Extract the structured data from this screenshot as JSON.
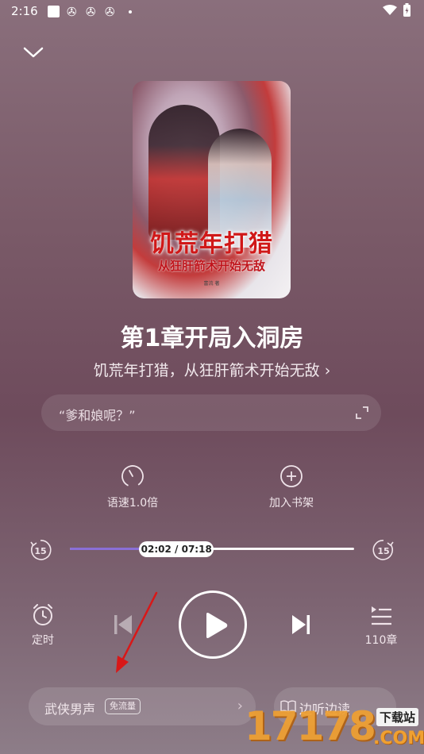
{
  "status_bar": {
    "time": "2:16"
  },
  "book": {
    "cover_title": "饥荒年打猎",
    "cover_subtitle": "从狂肝箭术开始无敌",
    "cover_author": "富流 著"
  },
  "chapter_title": "第1章开局入洞房",
  "book_title_link": "饥荒年打猎，从狂肝箭术开始无敌 ›",
  "quote": "“爹和娘呢？”",
  "actions": {
    "speed_label": "语速1.0倍",
    "add_shelf_label": "加入书架"
  },
  "player": {
    "time_display": "02:02 / 07:18",
    "progress": 0.28,
    "rewind_seconds": "15",
    "forward_seconds": "15"
  },
  "controls": {
    "timer_label": "定时",
    "chapters_label": "110章"
  },
  "voice": {
    "label": "武侠男声",
    "badge": "免流量"
  },
  "listen_read_label": "边听边读",
  "watermark": {
    "digits": "17178",
    "tag": "下载站",
    "domain": ".COM"
  },
  "colors": {
    "accent_progress": "#8a6fd8",
    "annotation_arrow": "#d81818"
  }
}
